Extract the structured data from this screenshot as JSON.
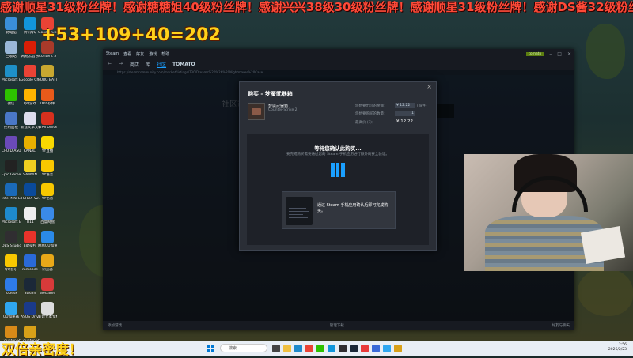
{
  "overlay": {
    "banner": "感谢顺星31级粉丝牌！感谢糖糖姐40级粉丝牌！感谢兴兴38级30级粉丝牌！感谢顺星31级粉丝牌！感谢DS酱32级粉丝牌！",
    "counter": "+53+109+40=202",
    "bottom_text": "双倍亲密度！"
  },
  "desktop_icons": [
    {
      "label": "此电脑",
      "color": "#3a8fd8"
    },
    {
      "label": "回收站",
      "color": "#9ab8d8"
    },
    {
      "label": "Microsoft Edge",
      "color": "#1e90c8"
    },
    {
      "label": "微信",
      "color": "#2dc100"
    },
    {
      "label": "控制面板",
      "color": "#4a78c8"
    },
    {
      "label": "CPUID ASUS CPU-Z",
      "color": "#6a4ab8"
    },
    {
      "label": "Epic Games Launcher",
      "color": "#222"
    },
    {
      "label": "Intel MKI Link Co...",
      "color": "#1a6ab8"
    },
    {
      "label": "Microsoft Edge",
      "color": "#1e8acb"
    },
    {
      "label": "OBS Studio",
      "color": "#302e31"
    },
    {
      "label": "QQ音乐",
      "color": "#f8c800"
    },
    {
      "label": "ToDesk",
      "color": "#2e7be8"
    },
    {
      "label": "UU加速器",
      "color": "#2fa7f0"
    },
    {
      "label": "Counter-Strike 2",
      "color": "#d88a18"
    }
  ],
  "desktop_icons_col2": [
    {
      "label": "腾讯QQ",
      "color": "#1296db"
    },
    {
      "label": "网易云音乐",
      "color": "#d81e06"
    },
    {
      "label": "Google Chrome",
      "color": "#ea4335"
    },
    {
      "label": "QQ游戏",
      "color": "#ffb400"
    },
    {
      "label": "新建文本文档",
      "color": "#dde"
    },
    {
      "label": "KANALI",
      "color": "#e8b000"
    },
    {
      "label": "SAMVIN",
      "color": "#f0d020"
    },
    {
      "label": "TURZX V2.0",
      "color": "#0a4a9a"
    },
    {
      "label": "Tl11",
      "color": "#eee"
    },
    {
      "label": "E键操控",
      "color": "#e8332a"
    },
    {
      "label": "iGmobile",
      "color": "#2a6ad8"
    },
    {
      "label": "Steam",
      "color": "#1b2838"
    },
    {
      "label": "ASUS DriverHub",
      "color": "#1a3a8a"
    },
    {
      "label": "Counter-Strike 2",
      "color": "#d8a018"
    }
  ],
  "desktop_icons_col3": [
    {
      "label": "Google Chrome",
      "color": "#ea4335"
    },
    {
      "label": "Content 5",
      "color": "#a83a2a"
    },
    {
      "label": "PUBG BATTLEGR...",
      "color": "#c8a830"
    },
    {
      "label": "DOS软件",
      "color": "#e85a1a"
    },
    {
      "label": "WPS Office",
      "color": "#d8301e"
    },
    {
      "label": "YY直播",
      "color": "#f8d800"
    },
    {
      "label": "YY语音",
      "color": "#f8c800"
    },
    {
      "label": "YY语音",
      "color": "#f8c800"
    },
    {
      "label": "百度网盘",
      "color": "#3a8ae8"
    },
    {
      "label": "网易UU加速器",
      "color": "#2a8ae8"
    },
    {
      "label": "浏览器",
      "color": "#e8a818"
    },
    {
      "label": "WeGame",
      "color": "#d83a3a"
    },
    {
      "label": "新建文本文档",
      "color": "#ddd"
    }
  ],
  "steam": {
    "titlebar_title": "Steam",
    "menu_items": [
      "Steam",
      "查看",
      "好友",
      "游戏",
      "帮助"
    ],
    "nav": {
      "store": "商店",
      "library": "库",
      "community": "社区",
      "username": "TOMATO"
    },
    "user_level": "tomato",
    "url": "https://steamcommunity.com/market/listings/730/Dreams%20%26%20Nightmares%20Case",
    "bg_title": "社区市场",
    "footer_left": "添加游戏",
    "footer_mid": "管理下载",
    "footer_right": "好友与聊天"
  },
  "dialog": {
    "title": "购买 - 梦魇武器箱",
    "item_name": "梦魇武器箱",
    "item_game": "Counter-Strike 2",
    "price_label": "您想要出价的金额：",
    "price_value": "¥ 12.22",
    "per_unit": "(每件)",
    "qty_label": "您想要购买的数量：",
    "qty_value": "1",
    "total_label": "最高价 (?)：",
    "total_value": "¥ 12.22",
    "wait_title": "等待您确认此购买...",
    "wait_desc": "要完成购买需要通过您的 Steam 手机应用进行额外的安全验证。",
    "app_card_text": "通过 Steam 手机应用确认后即可完成购买。"
  },
  "taskbar": {
    "search_placeholder": "搜索",
    "time": "2:56",
    "date": "2026/2/23"
  }
}
